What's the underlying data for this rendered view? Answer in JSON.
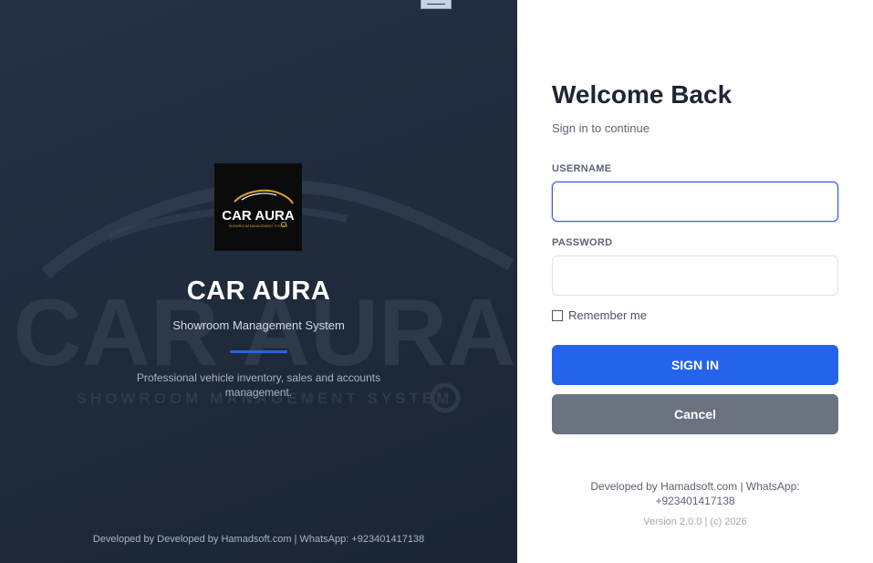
{
  "brand": {
    "logo_text": "CAR AURA",
    "logo_small": "SHOWROOM MANAGEMENT SYSTEM",
    "name": "CAR AURA",
    "tagline": "Showroom Management System",
    "description": "Professional vehicle inventory, sales and accounts management.",
    "watermark_text": "CAR AURA",
    "watermark_sub": "SHOWROOM MANAGEMENT SYSTEM",
    "footer": "Developed by Developed by Hamadsoft.com | WhatsApp: +923401417138"
  },
  "login": {
    "title": "Welcome Back",
    "subtitle": "Sign in to continue",
    "username_label": "USERNAME",
    "username_value": "",
    "password_label": "PASSWORD",
    "password_value": "",
    "remember_label": "Remember me",
    "signin_label": "SIGN IN",
    "cancel_label": "Cancel",
    "footer": "Developed by Hamadsoft.com | WhatsApp: +923401417138",
    "version": "Version 2.0.0  |  (c) 2026"
  },
  "colors": {
    "primary": "#2563eb",
    "secondary": "#6b7280",
    "panel": "#1f2a3a",
    "logo_gold": "#e0a23a"
  }
}
